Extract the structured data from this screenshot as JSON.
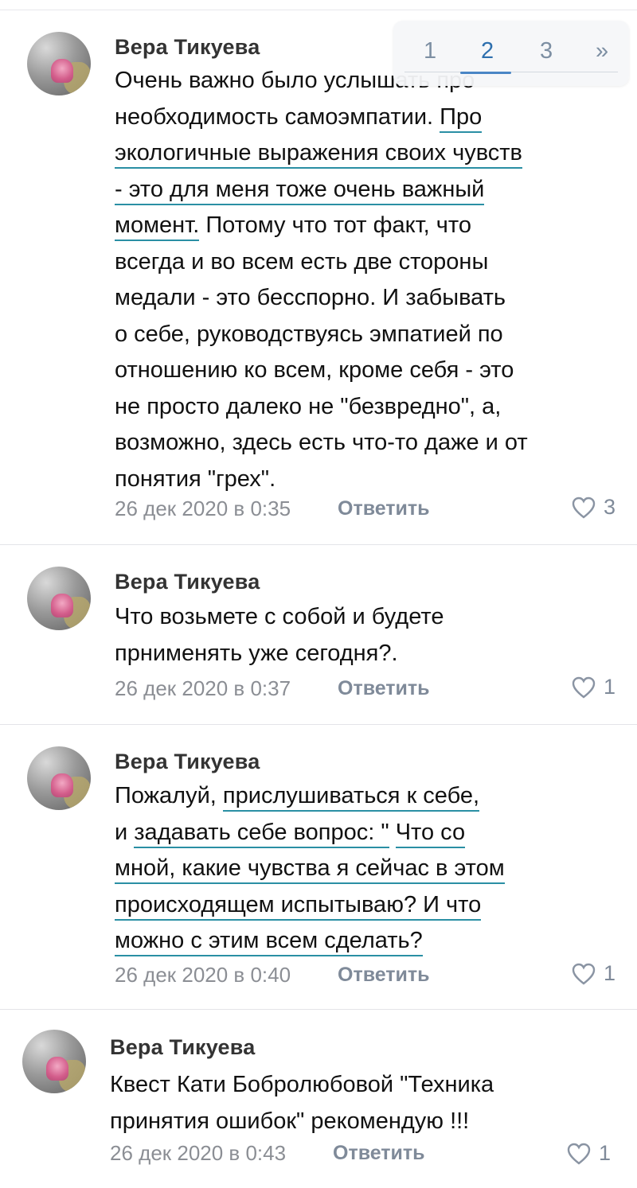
{
  "pagination": {
    "pages": [
      "1",
      "2",
      "3"
    ],
    "next": "»",
    "active": "2"
  },
  "comments": [
    {
      "author": "Вера Тикуева",
      "lines": [
        [
          "Очень важно было услышать про"
        ],
        [
          "необходимость самоэмпатии. ",
          "Про"
        ],
        [
          "экологичные выражения своих чувств"
        ],
        [
          "- это для меня тоже очень важный"
        ],
        [
          "момент.",
          " Потому что тот факт, что"
        ],
        [
          "всегда и во всем есть две стороны"
        ],
        [
          "медали - это бесспорно. И забывать"
        ],
        [
          "о себе, руководствуясь эмпатией по"
        ],
        [
          "отношению ко всем, кроме себя - это"
        ],
        [
          "не просто далеко не \"безвредно\", а,"
        ],
        [
          "возможно, здесь есть что-то даже и от"
        ],
        [
          "понятия \"грех\"."
        ]
      ],
      "date": "26 дек 2020 в 0:35",
      "reply": "Ответить",
      "likes": "3"
    },
    {
      "author": "Вера Тикуева",
      "lines": [
        [
          "Что возьмете с собой и будете"
        ],
        [
          "прнименять уже сегодня?."
        ]
      ],
      "date": "26 дек 2020 в 0:37",
      "reply": "Ответить",
      "likes": "1"
    },
    {
      "author": "Вера Тикуева",
      "lines": [
        [
          "Пожалуй, ",
          "прислушиваться к себе,"
        ],
        [
          "и ",
          "задавать себе вопрос: \"",
          " ",
          "Что со"
        ],
        [
          "мной, какие чувства я сейчас в этом"
        ],
        [
          "происходящем испытываю? И что"
        ],
        [
          "можно с этим всем сделать?"
        ]
      ],
      "date": "26 дек 2020 в 0:40",
      "reply": "Ответить",
      "likes": "1"
    },
    {
      "author": "Вера Тикуева",
      "lines": [
        [
          "Квест Кати Бобролюбовой \"Техника"
        ],
        [
          "принятия ошибок\" рекомендую !!!"
        ]
      ],
      "date": "26 дек 2020 в 0:43",
      "reply": "Ответить",
      "likes": "1"
    }
  ],
  "colors": {
    "underline": "#2a8fa4",
    "meta": "#8b8e94",
    "accent": "#2d6fae"
  }
}
